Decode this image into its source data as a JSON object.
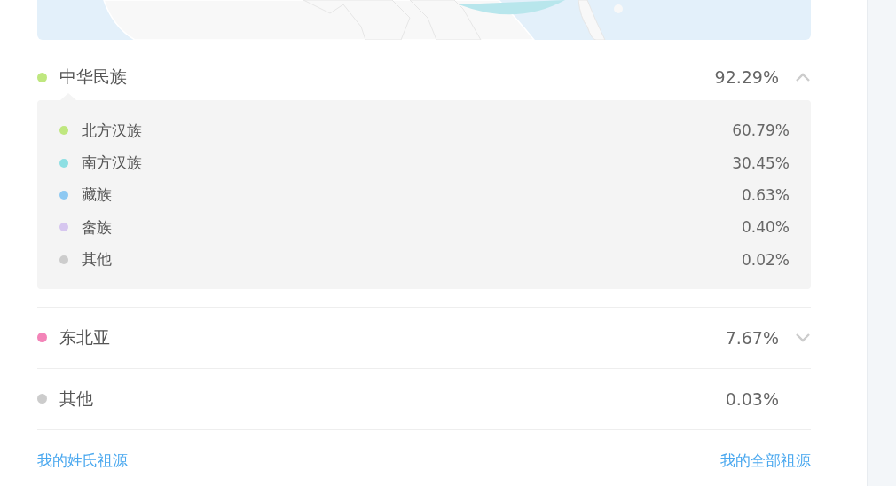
{
  "groups": [
    {
      "name": "中华民族",
      "color": "#bfe77f",
      "percent": "92.29%",
      "expanded": true,
      "children": [
        {
          "name": "北方汉族",
          "color": "#bfe77f",
          "percent": "60.79%"
        },
        {
          "name": "南方汉族",
          "color": "#8ddfe3",
          "percent": "30.45%"
        },
        {
          "name": "藏族",
          "color": "#8ec9f2",
          "percent": "0.63%"
        },
        {
          "name": "畲族",
          "color": "#d6c6ef",
          "percent": "0.40%"
        },
        {
          "name": "其他",
          "color": "#cccccc",
          "percent": "0.02%"
        }
      ]
    },
    {
      "name": "东北亚",
      "color": "#f384b8",
      "percent": "7.67%",
      "expanded": false
    },
    {
      "name": "其他",
      "color": "#cccccc",
      "percent": "0.03%"
    }
  ],
  "links": [
    "我的姓氏祖源",
    "我的全部祖源"
  ]
}
